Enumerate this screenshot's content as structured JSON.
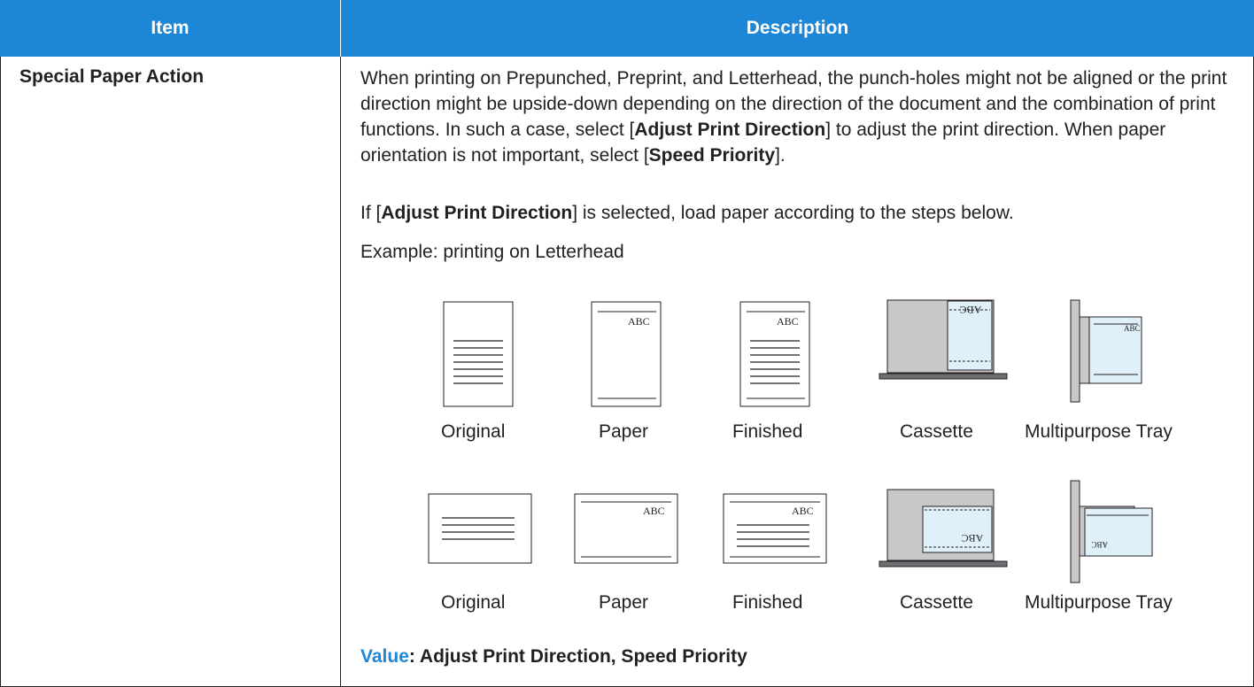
{
  "header": {
    "item": "Item",
    "description": "Description"
  },
  "row": {
    "item": "Special Paper Action",
    "para1": {
      "a": "When printing on Prepunched, Preprint, and Letterhead, the punch-holes might not be aligned or the print direction might be upside-down depending on the direction of the document and the combination of print functions. In such a case, select [",
      "b1": "Adjust Print Direction",
      "c": "] to adjust the print direction. When paper orientation is not important, select [",
      "b2": "Speed Priority",
      "d": "]."
    },
    "para2": {
      "a": "If [",
      "b": "Adjust Print Direction",
      "c": "] is selected, load paper according to the steps below."
    },
    "para3": "Example: printing on Letterhead",
    "row1_captions": [
      "Original",
      "Paper",
      "Finished",
      "Cassette",
      "Multipurpose Tray"
    ],
    "row2_captions": [
      "Original",
      "Paper",
      "Finished",
      "Cassette",
      "Multipurpose Tray"
    ],
    "figure_text": {
      "abc": "ABC",
      "abc_flipped": "ABC"
    },
    "value_label": "Value",
    "value_text": ": Adjust Print Direction, Speed Priority"
  },
  "colors": {
    "header_bg": "#1e86d6",
    "value_label": "#1e86d6",
    "tray_gray": "#c8c8c8",
    "paper_blue": "#dff0fb"
  }
}
